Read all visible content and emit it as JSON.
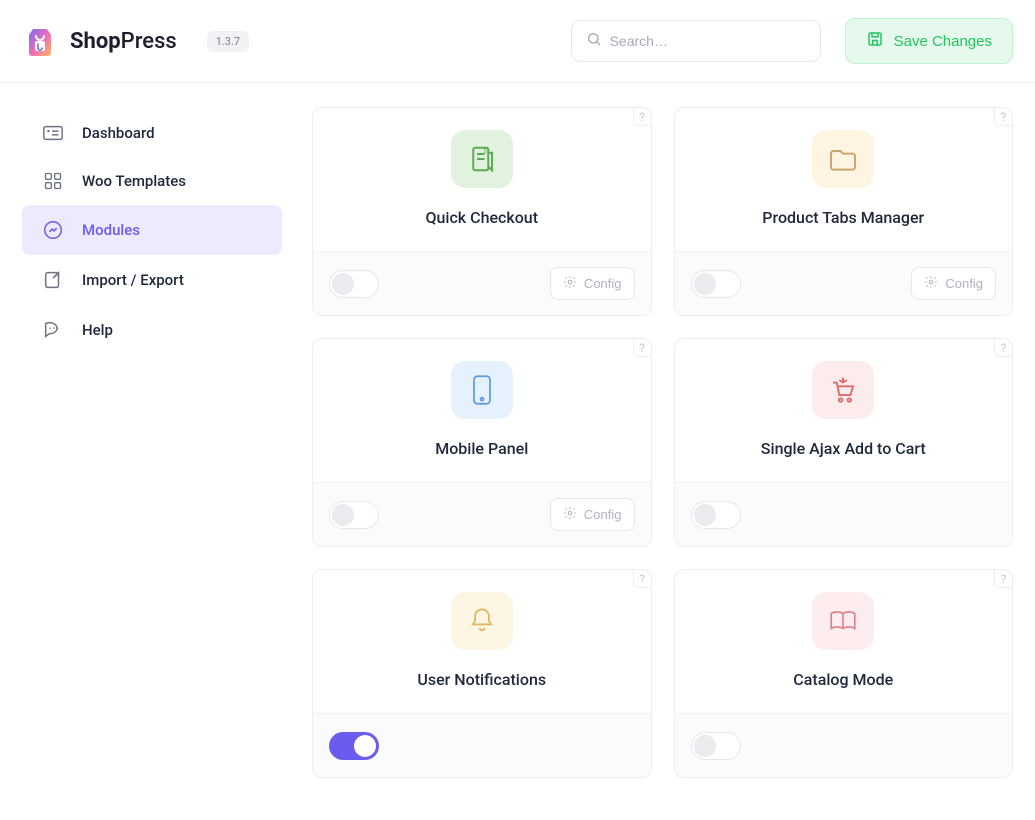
{
  "brand": {
    "name_strong": "Shop",
    "name_light": "Press"
  },
  "version": "1.3.7",
  "search": {
    "placeholder": "Search…"
  },
  "actions": {
    "save": "Save Changes"
  },
  "sidebar": {
    "items": [
      {
        "label": "Dashboard"
      },
      {
        "label": "Woo Templates"
      },
      {
        "label": "Modules"
      },
      {
        "label": "Import / Export"
      },
      {
        "label": "Help"
      }
    ],
    "active_index": 2
  },
  "modules": [
    {
      "title": "Quick Checkout",
      "icon": "receipt",
      "tint": "green",
      "enabled": false,
      "has_config": true
    },
    {
      "title": "Product Tabs Manager",
      "icon": "folder",
      "tint": "amber",
      "enabled": false,
      "has_config": true
    },
    {
      "title": "Mobile Panel",
      "icon": "phone",
      "tint": "blue",
      "enabled": false,
      "has_config": true
    },
    {
      "title": "Single Ajax Add to Cart",
      "icon": "cart",
      "tint": "red",
      "enabled": false,
      "has_config": false
    },
    {
      "title": "User Notifications",
      "icon": "bell",
      "tint": "yellow",
      "enabled": true,
      "has_config": false
    },
    {
      "title": "Catalog Mode",
      "icon": "book",
      "tint": "pink",
      "enabled": false,
      "has_config": false
    }
  ],
  "labels": {
    "config": "Config"
  }
}
